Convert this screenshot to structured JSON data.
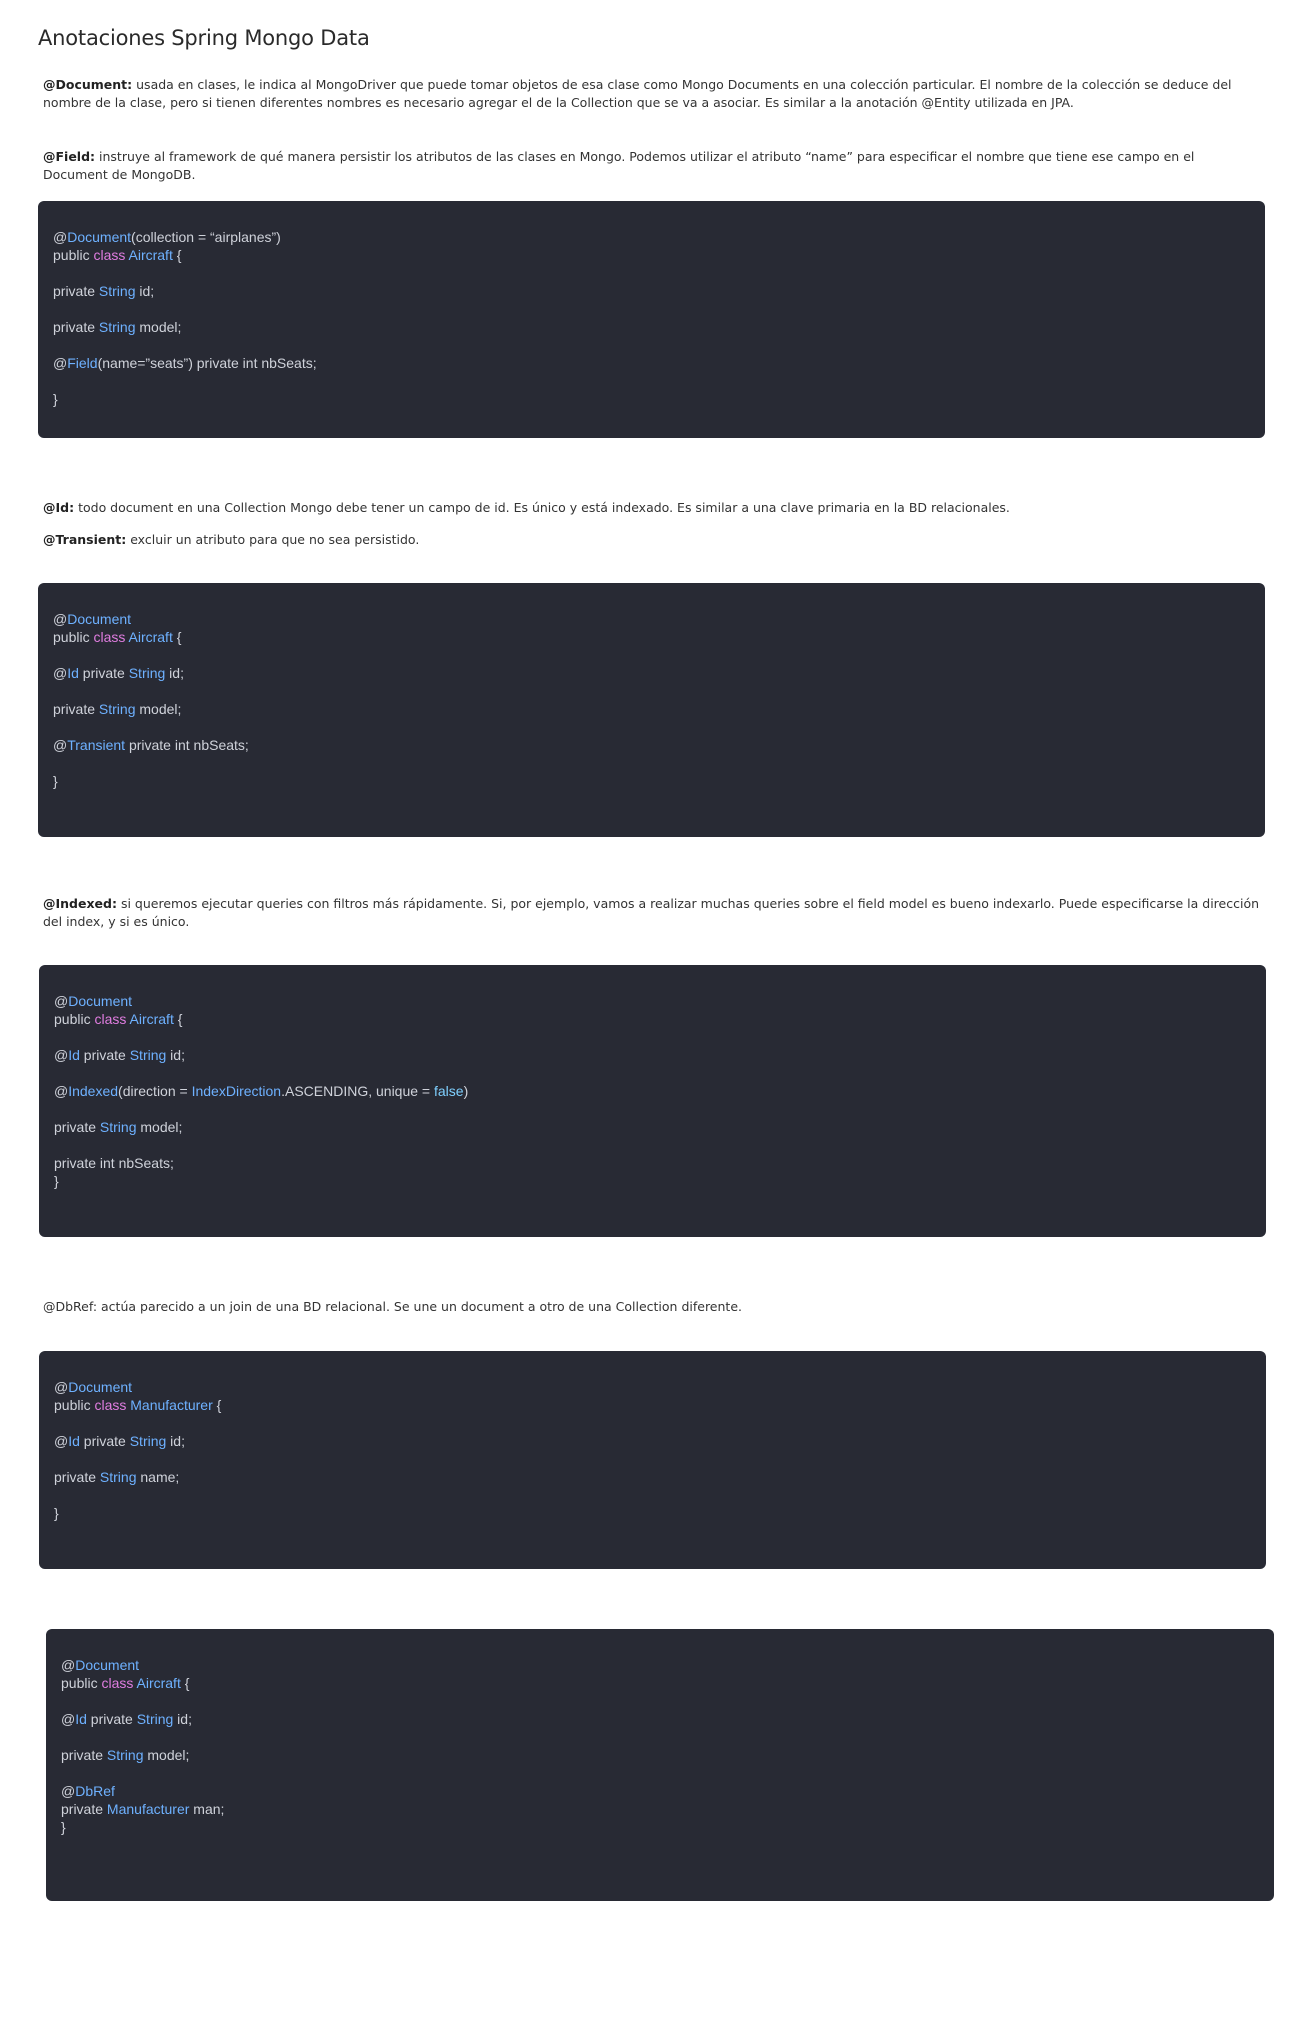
{
  "page": {
    "title": "Anotaciones Spring Mongo Data"
  },
  "paragraphs": {
    "document": {
      "term": "@Document:",
      "text": " usada en clases, le indica al MongoDriver que puede tomar objetos de esa clase como Mongo Documents en una colección particular. El nombre de la colección se deduce del nombre de la clase, pero si tienen diferentes nombres es necesario agregar el de la Collection que se va a asociar. Es similar a la anotación @Entity utilizada en JPA."
    },
    "field": {
      "term": "@Field:",
      "text": " instruye al framework de qué manera persistir los atributos de las clases en Mongo. Podemos utilizar el atributo “name” para especificar el nombre que tiene ese campo en el Document de MongoDB."
    },
    "id": {
      "term": "@Id:",
      "text": " todo document en una Collection Mongo debe tener un campo de id. Es único y está indexado. Es similar a una clave primaria en la BD relacionales."
    },
    "transient": {
      "term": "@Transient:",
      "text": " excluir un atributo para que no sea persistido."
    },
    "indexed": {
      "term": "@Indexed:",
      "text": " si queremos ejecutar queries con filtros más rápidamente. Si, por ejemplo, vamos a realizar muchas queries sobre el field model es bueno indexarlo. Puede especificarse la dirección del index, y si es único."
    },
    "dbref": {
      "text": "@DbRef: actúa parecido a un join de una BD relacional. Se une un document a otro de una Collection diferente."
    }
  },
  "code_blocks": {
    "block1": {
      "l1": {
        "at": "@",
        "ann": "Document",
        "rest": "(collection = “airplanes”)"
      },
      "l2": {
        "pre": "public ",
        "kw": "class",
        "sp": " ",
        "cls": "Aircraft",
        "rest": " {"
      },
      "l3": {
        "pre": "private ",
        "type": "String",
        "rest": " id;"
      },
      "l4": {
        "pre": "private ",
        "type": "String",
        "rest": " model;"
      },
      "l5": {
        "at": "@",
        "ann": "Field",
        "rest": "(name=”seats”) private int nbSeats;"
      },
      "l6": {
        "rest": "}"
      }
    },
    "block2": {
      "l1": {
        "at": "@",
        "ann": "Document"
      },
      "l2": {
        "pre": "public ",
        "kw": "class",
        "sp": " ",
        "cls": "Aircraft",
        "rest": " {"
      },
      "l3": {
        "at": "@",
        "ann": "Id",
        "pre": " private ",
        "type": "String",
        "rest": " id;"
      },
      "l4": {
        "pre": "private ",
        "type": "String",
        "rest": " model;"
      },
      "l5": {
        "at": "@",
        "ann": "Transient",
        "rest": " private int nbSeats;"
      },
      "l6": {
        "rest": "}"
      }
    },
    "block3": {
      "l1": {
        "at": "@",
        "ann": "Document"
      },
      "l2": {
        "pre": "public ",
        "kw": "class",
        "sp": " ",
        "cls": "Aircraft",
        "rest": " {"
      },
      "l3": {
        "at": "@",
        "ann": "Id",
        "pre": " private ",
        "type": "String",
        "rest": " id;"
      },
      "l4": {
        "at": "@",
        "ann": "Indexed",
        "p1": "(direction = ",
        "enum": "IndexDirection",
        "p2": ".ASCENDING, unique = ",
        "bool": "false",
        "p3": ")"
      },
      "l5": {
        "pre": "private ",
        "type": "String",
        "rest": " model;"
      },
      "l6": {
        "rest": "private int nbSeats;"
      },
      "l7": {
        "rest": "}"
      }
    },
    "block4": {
      "l1": {
        "at": "@",
        "ann": "Document"
      },
      "l2": {
        "pre": "public ",
        "kw": "class",
        "sp": " ",
        "cls": "Manufacturer",
        "rest": " {"
      },
      "l3": {
        "at": "@",
        "ann": "Id",
        "pre": " private ",
        "type": "String",
        "rest": " id;"
      },
      "l4": {
        "pre": "private ",
        "type": "String",
        "rest": " name;"
      },
      "l5": {
        "rest": "}"
      }
    },
    "block5": {
      "l1": {
        "at": "@",
        "ann": "Document"
      },
      "l2": {
        "pre": "public ",
        "kw": "class",
        "sp": " ",
        "cls": "Aircraft",
        "rest": " {"
      },
      "l3": {
        "at": "@",
        "ann": "Id",
        "pre": " private ",
        "type": "String",
        "rest": " id;"
      },
      "l4": {
        "pre": "private ",
        "type": "String",
        "rest": " model;"
      },
      "l5": {
        "at": "@",
        "ann": "DbRef"
      },
      "l6": {
        "pre": "private ",
        "cls": "Manufacturer",
        "rest": " man;"
      },
      "l7": {
        "rest": "}"
      }
    }
  },
  "colors": {
    "page_background": "#ffffff",
    "code_background": "#282a34",
    "code_text": "#cfd2da",
    "annotation": "#6eb1ff",
    "keyword_class": "#e07de0"
  }
}
